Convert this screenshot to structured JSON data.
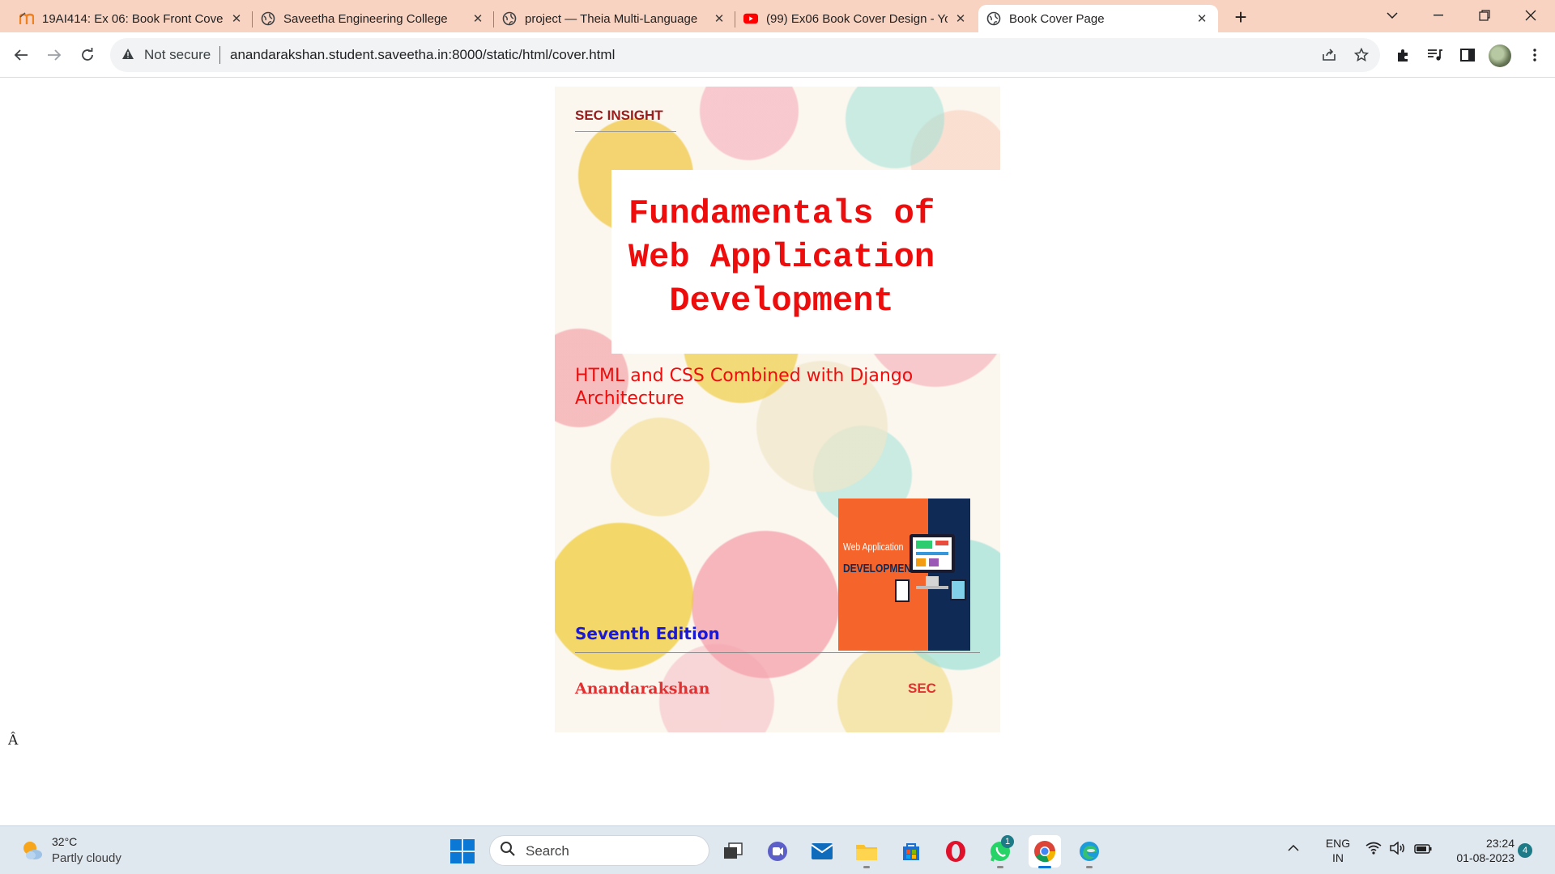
{
  "browser": {
    "tabs": [
      {
        "title": "19AI414: Ex 06: Book Front Cover",
        "icon": "moodle-icon",
        "active": false
      },
      {
        "title": "Saveetha Engineering College",
        "icon": "globe-icon",
        "active": false
      },
      {
        "title": "project — Theia Multi-Language",
        "icon": "globe-icon",
        "active": false
      },
      {
        "title": "(99) Ex06 Book Cover Design - Yo",
        "icon": "youtube-icon",
        "active": false
      },
      {
        "title": "Book Cover Page",
        "icon": "globe-icon",
        "active": true
      }
    ],
    "security_label": "Not secure",
    "url": "anandarakshan.student.saveetha.in:8000/static/html/cover.html"
  },
  "cover": {
    "brand": "SEC INSIGHT",
    "title_lines": [
      "Fundamentals of",
      "Web Application",
      "Development"
    ],
    "subtitle_lines": [
      "HTML and CSS Combined with Django",
      "Architecture"
    ],
    "thumbnail": {
      "line1": "Web Application",
      "line2": "DEVELOPMENT"
    },
    "edition": "Seventh Edition",
    "author": "Anandarakshan",
    "publisher": "SEC"
  },
  "page": {
    "stray_char": "Â"
  },
  "taskbar": {
    "weather": {
      "temp": "32°C",
      "desc": "Partly cloudy"
    },
    "search_placeholder": "Search",
    "whatsapp_badge": "1",
    "language": [
      "ENG",
      "IN"
    ],
    "time": "23:24",
    "date": "01-08-2023",
    "notification_count": "4"
  },
  "colors": {
    "title_red": "#ee0d0d",
    "edition_blue": "#1a1ad6",
    "brand_dark_red": "#9b1c1c",
    "tabstrip": "#f9d3c1"
  }
}
